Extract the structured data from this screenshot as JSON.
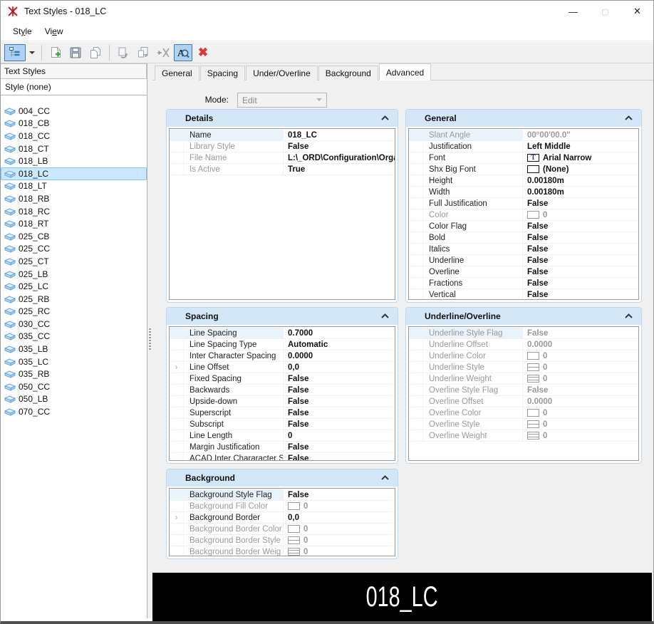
{
  "window": {
    "title": "Text Styles - 018_LC",
    "controls": {
      "minimize": "—",
      "maximize": "▢",
      "close": "✕"
    }
  },
  "menu": {
    "items": [
      {
        "pre": "St",
        "underlined": "y",
        "post": "le"
      },
      {
        "pre": "Vi",
        "underlined": "e",
        "post": "w"
      }
    ]
  },
  "toolbar": {
    "buttons": [
      {
        "name": "tree-view-toggle",
        "icon": "tree-view-icon",
        "active": true
      },
      {
        "name": "view-mode-dropdown",
        "icon": "chevron-down-icon",
        "active": false
      },
      {
        "name": "new-style-button",
        "icon": "new-file-plus-icon",
        "active": false
      },
      {
        "name": "save-style-button",
        "icon": "save-icon",
        "active": false
      },
      {
        "name": "copy-style-button",
        "icon": "copy-icon",
        "active": false
      },
      {
        "name": "import-style-button",
        "icon": "page-rotate-arrow-icon",
        "active": false
      },
      {
        "name": "copy-from-file-button",
        "icon": "page-return-arrow-icon",
        "active": false
      },
      {
        "name": "update-from-library-button",
        "icon": "send-to-app-icon",
        "active": false
      },
      {
        "name": "preview-toggle-button",
        "icon": "text-magnifier-icon",
        "active": true
      },
      {
        "name": "delete-style-button",
        "icon": "red-x-icon",
        "active": false
      }
    ]
  },
  "left_panel": {
    "header": "Text Styles",
    "none_item": "Style (none)",
    "selected": "018_LC",
    "styles": [
      "004_CC",
      "018_CB",
      "018_CC",
      "018_CT",
      "018_LB",
      "018_LC",
      "018_LT",
      "018_RB",
      "018_RC",
      "018_RT",
      "025_CB",
      "025_CC",
      "025_CT",
      "025_LB",
      "025_LC",
      "025_RB",
      "025_RC",
      "030_CC",
      "035_CC",
      "035_LB",
      "035_LC",
      "035_RB",
      "050_CC",
      "050_LB",
      "070_CC"
    ]
  },
  "tabs": {
    "items": [
      "General",
      "Spacing",
      "Under/Overline",
      "Background",
      "Advanced"
    ],
    "active": "Advanced"
  },
  "mode": {
    "label": "Mode:",
    "value": "Edit"
  },
  "panels": [
    {
      "id": "details",
      "title": "Details",
      "rows": [
        {
          "label": "Name",
          "value": "018_LC"
        },
        {
          "label": "Library Style",
          "value": "False",
          "label_dim": true
        },
        {
          "label": "File Name",
          "value": "L:\\_ORD\\Configuration\\Organ",
          "label_dim": true
        },
        {
          "label": "Is Active",
          "value": "True",
          "label_dim": true
        }
      ]
    },
    {
      "id": "general",
      "title": "General",
      "rows": [
        {
          "label": "Slant Angle",
          "value": "00°00'00.0\"",
          "label_dim": true,
          "value_dim": true
        },
        {
          "label": "Justification",
          "value": "Left Middle"
        },
        {
          "label": "Font",
          "value": "Arial Narrow",
          "swatch": "font"
        },
        {
          "label": "Shx Big Font",
          "value": "(None)",
          "swatch": "box"
        },
        {
          "label": "Height",
          "value": "0.00180m"
        },
        {
          "label": "Width",
          "value": "0.00180m"
        },
        {
          "label": "Full Justification",
          "value": "False"
        },
        {
          "label": "Color",
          "value": "0",
          "swatch": "box",
          "label_dim": true,
          "value_dim": true
        },
        {
          "label": "Color Flag",
          "value": "False"
        },
        {
          "label": "Bold",
          "value": "False"
        },
        {
          "label": "Italics",
          "value": "False"
        },
        {
          "label": "Underline",
          "value": "False"
        },
        {
          "label": "Overline",
          "value": "False"
        },
        {
          "label": "Fractions",
          "value": "False"
        },
        {
          "label": "Vertical",
          "value": "False"
        }
      ]
    },
    {
      "id": "spacing",
      "title": "Spacing",
      "rows": [
        {
          "label": "Line Spacing",
          "value": "0.7000"
        },
        {
          "label": "Line Spacing Type",
          "value": "Automatic"
        },
        {
          "label": "Inter Character Spacing",
          "value": "0.0000"
        },
        {
          "label": "Line Offset",
          "value": "0,0",
          "expander": true
        },
        {
          "label": "Fixed Spacing",
          "value": "False"
        },
        {
          "label": "Backwards",
          "value": "False"
        },
        {
          "label": "Upside-down",
          "value": "False"
        },
        {
          "label": "Superscript",
          "value": "False"
        },
        {
          "label": "Subscript",
          "value": "False"
        },
        {
          "label": "Line Length",
          "value": "0"
        },
        {
          "label": "Margin Justification",
          "value": "False"
        },
        {
          "label": "ACAD Inter Chararacter S",
          "value": "False"
        }
      ]
    },
    {
      "id": "underline",
      "title": "Underline/Overline",
      "rows": [
        {
          "label": "Underline Style Flag",
          "value": "False",
          "label_dim": true,
          "value_dim": true
        },
        {
          "label": "Underline Offset",
          "value": "0.0000",
          "label_dim": true,
          "value_dim": true
        },
        {
          "label": "Underline Color",
          "value": "0",
          "swatch": "box",
          "label_dim": true,
          "value_dim": true
        },
        {
          "label": "Underline Style",
          "value": "0",
          "swatch": "style",
          "label_dim": true,
          "value_dim": true
        },
        {
          "label": "Underline Weight",
          "value": "0",
          "swatch": "weight",
          "label_dim": true,
          "value_dim": true
        },
        {
          "label": "Overline Style Flag",
          "value": "False",
          "label_dim": true,
          "value_dim": true
        },
        {
          "label": "Overline Offset",
          "value": "0.0000",
          "label_dim": true,
          "value_dim": true
        },
        {
          "label": "Overline Color",
          "value": "0",
          "swatch": "box",
          "label_dim": true,
          "value_dim": true
        },
        {
          "label": "Overline Style",
          "value": "0",
          "swatch": "style",
          "label_dim": true,
          "value_dim": true
        },
        {
          "label": "Overline Weight",
          "value": "0",
          "swatch": "weight",
          "label_dim": true,
          "value_dim": true
        }
      ]
    },
    {
      "id": "background",
      "title": "Background",
      "rows": [
        {
          "label": "Background Style Flag",
          "value": "False"
        },
        {
          "label": "Background Fill Color",
          "value": "0",
          "swatch": "box",
          "label_dim": true,
          "value_dim": true
        },
        {
          "label": "Background Border",
          "value": "0,0",
          "expander": true
        },
        {
          "label": "Background Border Color",
          "value": "0",
          "swatch": "box",
          "label_dim": true,
          "value_dim": true
        },
        {
          "label": "Background Border Style",
          "value": "0",
          "swatch": "style",
          "label_dim": true,
          "value_dim": true
        },
        {
          "label": "Background Border Weig",
          "value": "0",
          "swatch": "weight",
          "label_dim": true,
          "value_dim": true
        }
      ]
    }
  ],
  "preview": {
    "text": "018_LC",
    "background": "#000000",
    "color": "#ffffff"
  },
  "colors": {
    "panel_header": "#d4e7f8",
    "panel_border": "#bcd8ef",
    "selection": "#cce8ff",
    "selection_border": "#84c1ff",
    "active_button_bg": "#aed2ef",
    "active_button_border": "#3b7ab0",
    "delete_red": "#d63a3a",
    "content_bg": "#f0f0f0"
  }
}
